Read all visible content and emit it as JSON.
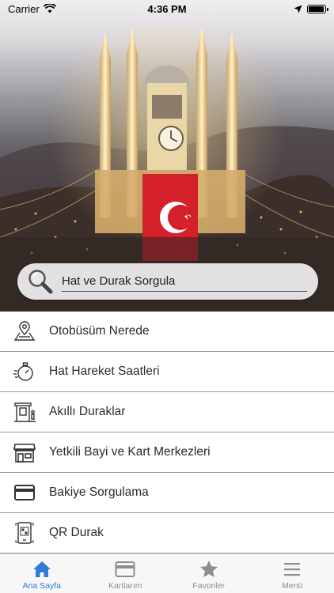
{
  "status_bar": {
    "carrier": "Carrier",
    "time": "4:36 PM",
    "battery_level": 0.95
  },
  "search": {
    "label": "Hat ve Durak Sorgula"
  },
  "menu": [
    {
      "label": "Otobüsüm Nerede",
      "icon": "map-pin-icon"
    },
    {
      "label": "Hat Hareket Saatleri",
      "icon": "stopwatch-icon"
    },
    {
      "label": "Akıllı Duraklar",
      "icon": "bus-stop-icon"
    },
    {
      "label": "Yetkili Bayi ve Kart Merkezleri",
      "icon": "store-icon"
    },
    {
      "label": "Bakiye Sorgulama",
      "icon": "card-icon"
    },
    {
      "label": "QR Durak",
      "icon": "qr-phone-icon"
    }
  ],
  "tabs": [
    {
      "label": "Ana Sayfa",
      "icon": "home-icon",
      "active": true
    },
    {
      "label": "Kartlarım",
      "icon": "card-icon",
      "active": false
    },
    {
      "label": "Favoriler",
      "icon": "star-icon",
      "active": false
    },
    {
      "label": "Menü",
      "icon": "hamburger-icon",
      "active": false
    }
  ],
  "colors": {
    "accent": "#2f7bd6",
    "inactive": "#8e8e8e",
    "flag_red": "#d3202a"
  }
}
